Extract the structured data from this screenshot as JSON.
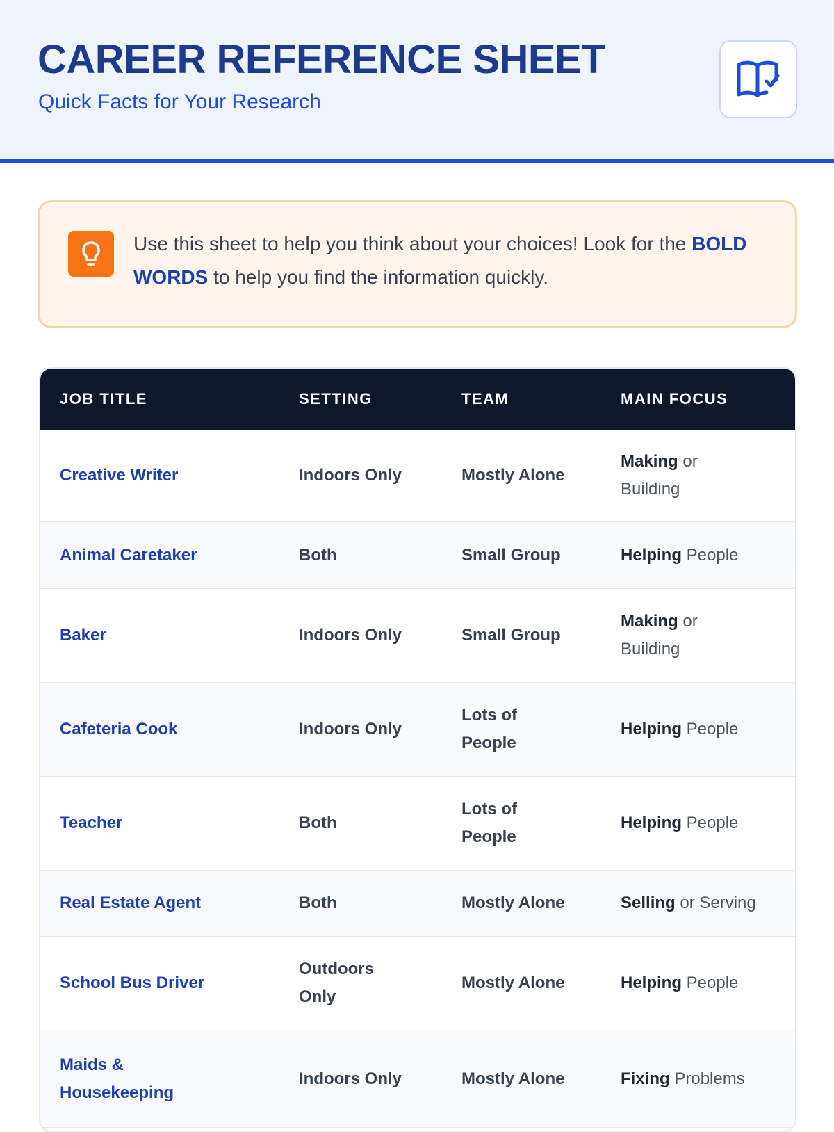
{
  "header": {
    "title": "CAREER REFERENCE SHEET",
    "subtitle": "Quick Facts for Your Research",
    "icon": "book-check-icon"
  },
  "tip": {
    "icon": "lightbulb-icon",
    "text_before": "Use this sheet to help you think about your choices! Look for the ",
    "bold": "BOLD WORDS",
    "text_after": " to help you find the information quickly."
  },
  "table": {
    "headers": [
      "JOB TITLE",
      "SETTING",
      "TEAM",
      "MAIN FOCUS"
    ],
    "rows": [
      {
        "job": "Creative Writer",
        "setting": "Indoors Only",
        "team": "Mostly Alone",
        "focus_bold": "Making",
        "focus_rest": " or Building"
      },
      {
        "job": "Animal Caretaker",
        "setting": "Both",
        "team": "Small Group",
        "focus_bold": "Helping",
        "focus_rest": " People"
      },
      {
        "job": "Baker",
        "setting": "Indoors Only",
        "team": "Small Group",
        "focus_bold": "Making",
        "focus_rest": " or Building"
      },
      {
        "job": "Cafeteria Cook",
        "setting": "Indoors Only",
        "team": "Lots of People",
        "focus_bold": "Helping",
        "focus_rest": " People"
      },
      {
        "job": "Teacher",
        "setting": "Both",
        "team": "Lots of People",
        "focus_bold": "Helping",
        "focus_rest": " People"
      },
      {
        "job": "Real Estate Agent",
        "setting": "Both",
        "team": "Mostly Alone",
        "focus_bold": "Selling",
        "focus_rest": " or Serving"
      },
      {
        "job": "School Bus Driver",
        "setting": "Outdoors Only",
        "team": "Mostly Alone",
        "focus_bold": "Helping",
        "focus_rest": " People"
      },
      {
        "job": "Maids & Housekeeping",
        "setting": "Indoors Only",
        "team": "Mostly Alone",
        "focus_bold": "Fixing",
        "focus_rest": " Problems"
      }
    ]
  },
  "colors": {
    "accent": "#1d4ed8",
    "title": "#1e3a8a",
    "tip_icon": "#f97316",
    "table_header": "#0f172a"
  }
}
